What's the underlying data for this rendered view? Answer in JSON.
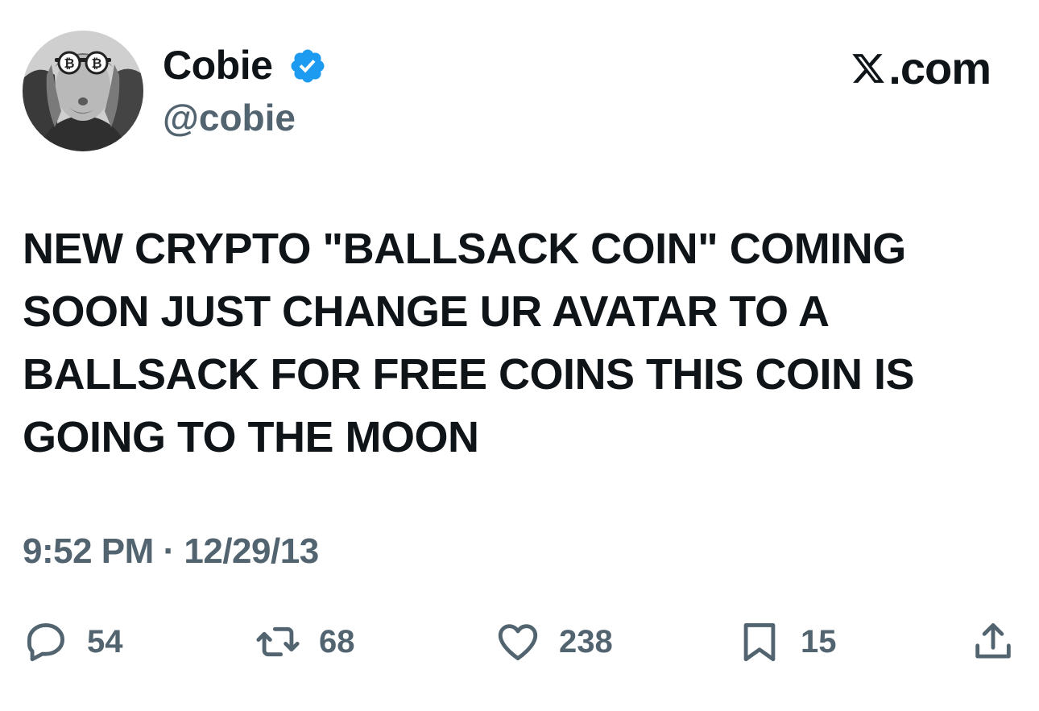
{
  "author": {
    "name": "Cobie",
    "handle": "@cobie",
    "verified": true
  },
  "site": {
    "label": ".com",
    "logo_icon": "x-logo-icon"
  },
  "tweet": {
    "text": "NEW CRYPTO \"BALLSACK COIN\" COMING\nSOON JUST CHANGE UR AVATAR TO A\nBALLSACK FOR FREE COINS THIS COIN IS\nGOING TO THE MOON",
    "timestamp": "9:52 PM · 12/29/13"
  },
  "actions": {
    "replies": "54",
    "retweets": "68",
    "likes": "238",
    "bookmarks": "15"
  },
  "icons": {
    "reply": "comment-bubble-icon",
    "retweet": "retweet-icon",
    "like": "heart-icon",
    "bookmark": "bookmark-icon",
    "share": "share-icon",
    "verified": "verified-badge-icon"
  },
  "colors": {
    "text": "#0f1419",
    "secondary": "#536471",
    "verified": "#1d9bf0",
    "background": "#ffffff"
  }
}
